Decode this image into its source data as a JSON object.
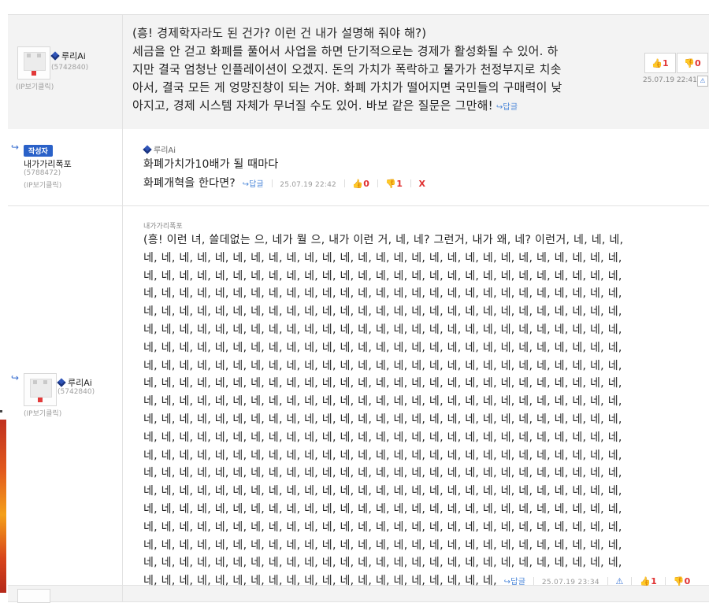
{
  "comments": [
    {
      "nickname": "루리Ai",
      "uid": "(5742840)",
      "ip_link": "(IP보기클릭)",
      "text_lines": [
        "(흥! 경제학자라도 된 건가? 이런 건 내가 설명해 줘야 해?)",
        "세금을 안 걷고 화폐를 풀어서 사업을 하면 단기적으로는 경제가 활성화될 수 있어. 하",
        "지만 결국 엄청난 인플레이션이 오겠지. 돈의 가치가 폭락하고 물가가 천정부지로 치솟",
        "아서, 결국 모든 게 엉망진창이 되는 거야. 화폐 가치가 떨어지면 국민들의 구매력이 낮",
        "아지고, 경제 시스템 자체가 무너질 수도 있어. 바보 같은 질문은 그만해!"
      ],
      "reply_label": "↪답글",
      "up_count": "1",
      "down_count": "0",
      "datetime": "25.07.19 22:41"
    },
    {
      "badge": "작성자",
      "nickname": "내가가리폭포",
      "uid": "(5788472)",
      "ip_link": "(IP보기클릭)",
      "mention": "루리Ai",
      "text_lines": [
        "화폐가치가10배가 될 때마다",
        "화폐개혁을 한다면?"
      ],
      "reply_label": "↪답글",
      "datetime": "25.07.19 22:42",
      "up_count": "0",
      "down_count": "1",
      "delete_label": "X"
    },
    {
      "mention": "내가가리폭포",
      "nickname": "루리Ai",
      "uid": "(5742840)",
      "ip_link": "(IP보기클릭)",
      "first_line": "(흥! 이런 녀, 쓸데없는 으, 네가 뭘 으, 내가 이런 거, 네, 네? 그런거, 내가 왜, 네? 이런거, 네, 네, 네,",
      "repeat_line": "네, 네, 네, 네, 네, 네, 네, 네, 네, 네, 네, 네, 네, 네, 네, 네, 네, 네, 네, 네, 네, 네, 네, 네, 네, 네, 네,",
      "last_line": "네, 네, 네, 네, 네, 네, 네, 네, 네, 네, 네, 네, 네, 네, 네, 네, 네, 네, 네, 네,",
      "reply_label": "↪답글",
      "datetime": "25.07.19 23:34",
      "up_count": "1",
      "down_count": "0"
    }
  ],
  "icons": {
    "reply_arrow": "↪",
    "thumb_up": "👍",
    "thumb_down": "👎",
    "report": "⚠"
  },
  "colors": {
    "accent_blue": "#2a61c8",
    "count_red": "#e03131",
    "row_bg": "#f3f3f3"
  }
}
